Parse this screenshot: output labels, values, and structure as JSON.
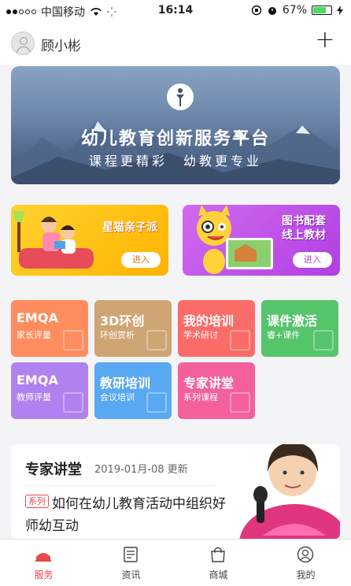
{
  "status_bar": {
    "carrier": "中国移动",
    "time": "16:14",
    "battery": "67%",
    "battery_level": 0.67
  },
  "header": {
    "username": "顾小彬",
    "add_icon": "plus-icon"
  },
  "banner": {
    "title": "幼儿教育创新服务平台",
    "subtitle": "课程更精彩　幼教更专业"
  },
  "promos": [
    {
      "title": "星猫亲子派",
      "button": "进入"
    },
    {
      "title_line1": "图书配套",
      "title_line2": "线上教材",
      "button": "进入"
    }
  ],
  "tiles": [
    {
      "title": "EMQA",
      "sub": "家长评量",
      "color": "#ff8d5e"
    },
    {
      "title": "3D环创",
      "sub": "环创赏析",
      "color": "#cfa574"
    },
    {
      "title": "我的培训",
      "sub": "学术研讨",
      "color": "#fb6c68"
    },
    {
      "title": "课件激活",
      "sub": "睿+课件",
      "color": "#56c46b"
    },
    {
      "title": "EMQA",
      "sub": "教师评量",
      "color": "#b082f0"
    },
    {
      "title": "教研培训",
      "sub": "会议培训",
      "color": "#58a8f2"
    },
    {
      "title": "专家讲堂",
      "sub": "系列课程",
      "color": "#f3609c"
    }
  ],
  "expert": {
    "title": "专家讲堂",
    "date": "2019-01月-08 更新",
    "tag": "系列",
    "headline": "如何在幼儿教育活动中组织好师幼互动"
  },
  "tabbar": {
    "items": [
      {
        "label": "服务",
        "icon": "service-icon"
      },
      {
        "label": "资讯",
        "icon": "news-icon"
      },
      {
        "label": "商城",
        "icon": "shop-icon"
      },
      {
        "label": "我的",
        "icon": "profile-icon"
      }
    ],
    "active_color": "#e8474b"
  }
}
